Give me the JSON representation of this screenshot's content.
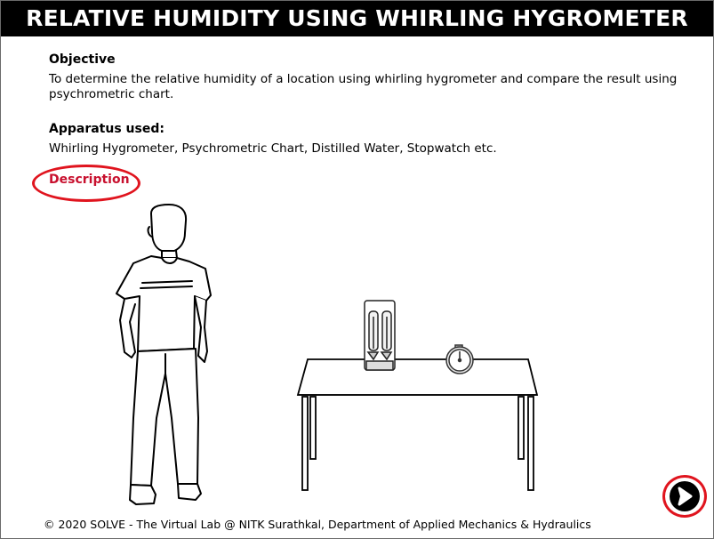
{
  "title": "RELATIVE HUMIDITY USING WHIRLING HYGROMETER",
  "objective": {
    "heading": "Objective",
    "text": "To determine the relative humidity of a location using whirling hygrometer and compare the result using psychrometric chart."
  },
  "apparatus": {
    "heading": "Apparatus used:",
    "text": "Whirling Hygrometer, Psychrometric Chart, Distilled Water, Stopwatch etc."
  },
  "description_link": "Description",
  "footer": "© 2020 SOLVE - The Virtual Lab @ NITK Surathkal, Department of Applied Mechanics & Hydraulics",
  "icons": {
    "next": "arrow-right-circle-icon"
  },
  "colors": {
    "title_bg": "#000000",
    "title_text": "#ffffff",
    "highlight": "#e0141e",
    "link": "#c8102e"
  }
}
